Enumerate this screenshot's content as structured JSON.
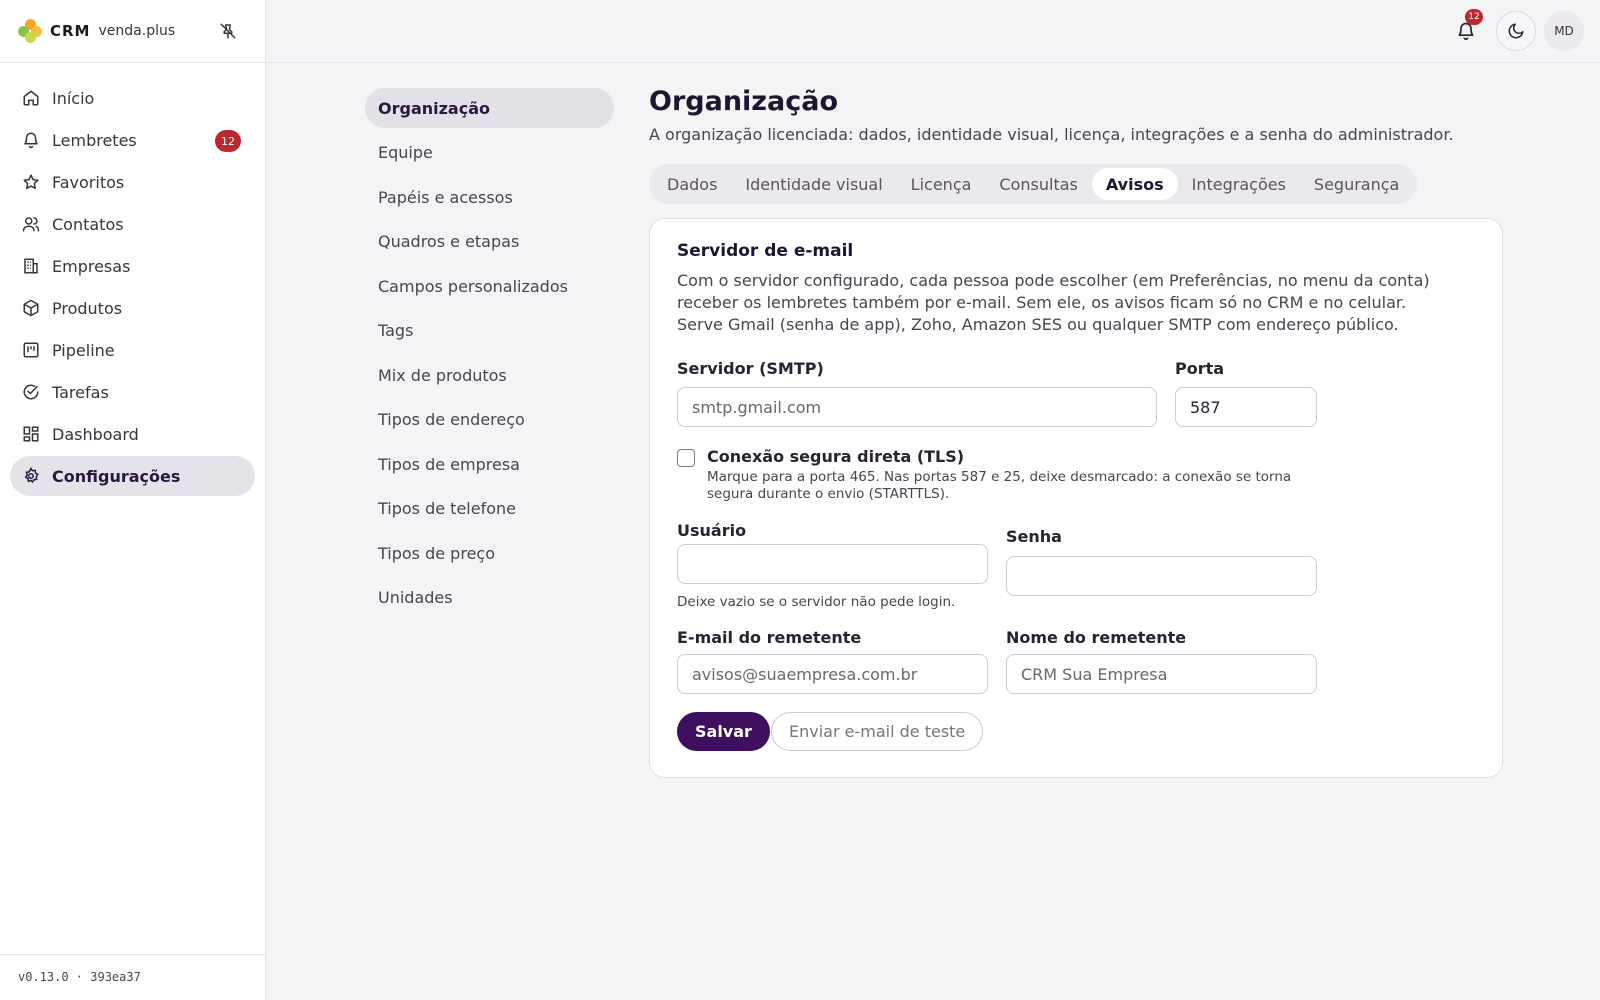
{
  "brand": {
    "crm": "CRM",
    "name": "venda.plus"
  },
  "sidebar": {
    "items": [
      {
        "label": "Início",
        "icon": "home-icon"
      },
      {
        "label": "Lembretes",
        "icon": "bell-icon",
        "badge": "12"
      },
      {
        "label": "Favoritos",
        "icon": "star-icon"
      },
      {
        "label": "Contatos",
        "icon": "users-icon"
      },
      {
        "label": "Empresas",
        "icon": "building-icon"
      },
      {
        "label": "Produtos",
        "icon": "box-icon"
      },
      {
        "label": "Pipeline",
        "icon": "kanban-icon"
      },
      {
        "label": "Tarefas",
        "icon": "check-circle-icon"
      },
      {
        "label": "Dashboard",
        "icon": "dashboard-icon"
      },
      {
        "label": "Configurações",
        "icon": "gear-icon",
        "active": true
      }
    ],
    "version": "v0.13.0 · 393ea37"
  },
  "topbar": {
    "notifications_badge": "12",
    "avatar_initials": "MD"
  },
  "subnav": {
    "items": [
      {
        "label": "Organização",
        "active": true
      },
      {
        "label": "Equipe"
      },
      {
        "label": "Papéis e acessos"
      },
      {
        "label": "Quadros e etapas"
      },
      {
        "label": "Campos personalizados"
      },
      {
        "label": "Tags"
      },
      {
        "label": "Mix de produtos"
      },
      {
        "label": "Tipos de endereço"
      },
      {
        "label": "Tipos de empresa"
      },
      {
        "label": "Tipos de telefone"
      },
      {
        "label": "Tipos de preço"
      },
      {
        "label": "Unidades"
      }
    ]
  },
  "main": {
    "title": "Organização",
    "subtitle": "A organização licenciada: dados, identidade visual, licença, integrações e a senha do administrador.",
    "tabs": [
      {
        "label": "Dados"
      },
      {
        "label": "Identidade visual"
      },
      {
        "label": "Licença"
      },
      {
        "label": "Consultas"
      },
      {
        "label": "Avisos",
        "active": true
      },
      {
        "label": "Integrações"
      },
      {
        "label": "Segurança"
      }
    ]
  },
  "card": {
    "title": "Servidor de e-mail",
    "description": "Com o servidor configurado, cada pessoa pode escolher (em Preferências, no menu da conta) receber os lembretes também por e-mail. Sem ele, os avisos ficam só no CRM e no celular. Serve Gmail (senha de app), Zoho, Amazon SES ou qualquer SMTP com endereço público.",
    "smtp": {
      "label": "Servidor (SMTP)",
      "value": "",
      "placeholder": "smtp.gmail.com"
    },
    "port": {
      "label": "Porta",
      "value": "587"
    },
    "tls": {
      "label": "Conexão segura direta (TLS)",
      "help": "Marque para a porta 465. Nas portas 587 e 25, deixe desmarcado: a conexão se torna segura durante o envio (STARTTLS).",
      "checked": false
    },
    "user": {
      "label": "Usuário",
      "value": "",
      "help": "Deixe vazio se o servidor não pede login."
    },
    "password": {
      "label": "Senha",
      "value": ""
    },
    "sender_email": {
      "label": "E-mail do remetente",
      "value": "",
      "placeholder": "avisos@suaempresa.com.br"
    },
    "sender_name": {
      "label": "Nome do remetente",
      "value": "",
      "placeholder": "CRM Sua Empresa"
    },
    "save_label": "Salvar",
    "test_label": "Enviar e-mail de teste"
  },
  "colors": {
    "accent": "#3d0f5e",
    "badge": "#c0262d",
    "active_bg": "#e6e2ea"
  }
}
